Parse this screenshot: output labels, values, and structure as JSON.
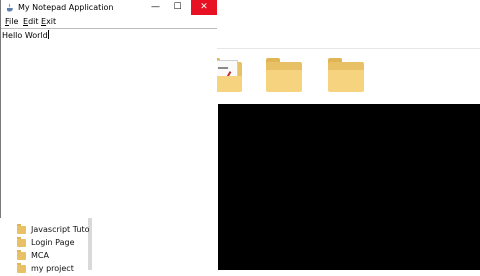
{
  "notepad": {
    "title": "My Notepad Application",
    "controls": {
      "minimize": "—",
      "maximize": "☐",
      "close": "✕"
    },
    "menus": [
      {
        "mnemonic": "F",
        "rest": "ile"
      },
      {
        "mnemonic": "E",
        "rest": "dit"
      },
      {
        "mnemonic": "E",
        "rest": "xit"
      }
    ],
    "editor_text": "Hello World"
  },
  "explorer": {
    "folder_tiles": [
      "folder-icon",
      "folder-with-document-icon",
      "folder-with-pen-icon",
      "folder-icon",
      "folder-icon"
    ],
    "tree_items": [
      {
        "label": "Javascript Tuto"
      },
      {
        "label": "Login Page"
      },
      {
        "label": "MCA"
      },
      {
        "label": "my project"
      }
    ]
  },
  "colors": {
    "close_button": "#e81123",
    "folder": "#f6d37e",
    "background_video": "#000000"
  }
}
